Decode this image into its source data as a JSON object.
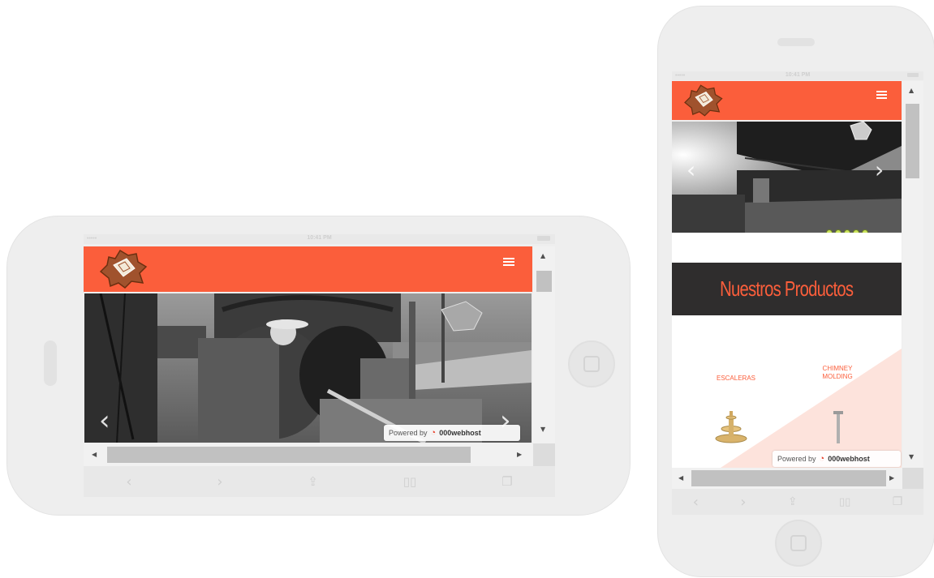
{
  "status_bar": {
    "carrier": "•••••",
    "time": "10:41 PM"
  },
  "landscape": {
    "powered_by": "Powered by",
    "host_brand": "000webhost"
  },
  "portrait": {
    "section_title": "Nuestros Productos",
    "products": [
      {
        "label": "ESCALERAS"
      },
      {
        "label": "CHIMNEY\nMOLDING"
      }
    ],
    "powered_by": "Powered by",
    "host_brand": "000webhost",
    "slide_dots": 5
  },
  "icons": {
    "menu": "hamburger-icon",
    "prev": "chevron-left-icon",
    "next": "chevron-right-icon",
    "back": "back-icon",
    "forward": "forward-icon",
    "share": "share-icon",
    "bookmarks": "book-icon",
    "tabs": "tabs-icon"
  },
  "colors": {
    "header": "#fb5e3b",
    "band": "#2f2d2d",
    "accent": "#fb5e3b"
  }
}
